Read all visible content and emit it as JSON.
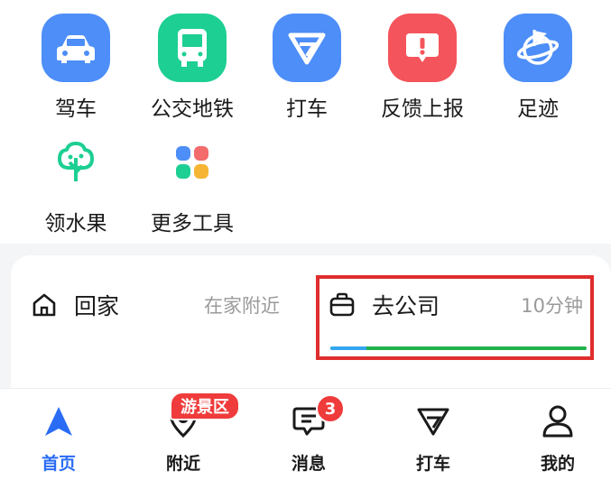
{
  "tools": [
    {
      "label": "驾车",
      "icon": "car-icon",
      "color": "#4d8ef8"
    },
    {
      "label": "公交地铁",
      "icon": "bus-icon",
      "color": "#1dcf93"
    },
    {
      "label": "打车",
      "icon": "taxi-icon",
      "color": "#4d8ef8"
    },
    {
      "label": "反馈上报",
      "icon": "feedback-icon",
      "color": "#f4545b"
    },
    {
      "label": "足迹",
      "icon": "footprint-icon",
      "color": "#4d8ef8"
    },
    {
      "label": "领水果",
      "icon": "fruit-tree-icon",
      "color": "#1dcf93"
    },
    {
      "label": "更多工具",
      "icon": "more-tools-icon",
      "color": "#f36b6b"
    }
  ],
  "destinations": {
    "home": {
      "label": "回家",
      "sub": "在家附近",
      "icon": "home-icon"
    },
    "work": {
      "label": "去公司",
      "sub": "10分钟",
      "icon": "briefcase-icon",
      "progress": 0.14
    }
  },
  "tabbar": {
    "tabs": [
      {
        "label": "首页",
        "icon": "navigation-arrow-icon",
        "active": true
      },
      {
        "label": "附近",
        "icon": "location-pin-icon"
      },
      {
        "label": "消息",
        "icon": "message-icon"
      },
      {
        "label": "打车",
        "icon": "taxi-icon"
      },
      {
        "label": "我的",
        "icon": "profile-icon"
      }
    ],
    "scenic_badge": "游景区",
    "message_count": "3"
  },
  "colors": {
    "accent": "#2a6cf6",
    "highlight": "#e02d2d",
    "progress_green": "#21b24b",
    "progress_blue": "#33a7f0"
  }
}
